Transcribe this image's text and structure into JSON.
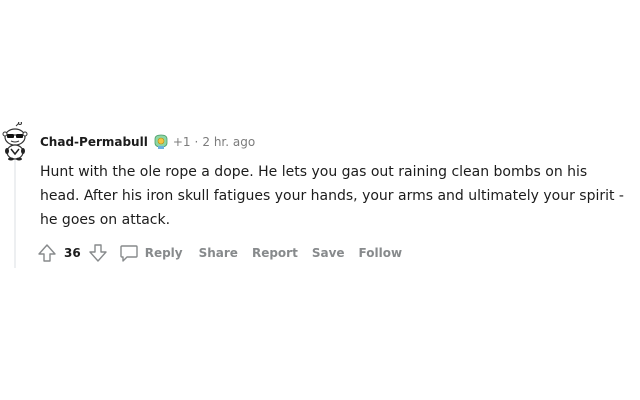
{
  "comment": {
    "username": "Chad-Permabull",
    "award_icon": "award-icon",
    "karma": "+1",
    "separator": "·",
    "time": "2 hr. ago",
    "body": [
      "Hunt with the ole rope a dope. He lets you gas out raining clean bombs on his head. After his iron skull fatigues your hands, your arms and ultimately your spirit - he goes on attack."
    ],
    "score": "36",
    "actions": {
      "reply": "Reply",
      "share": "Share",
      "report": "Report",
      "save": "Save",
      "follow": "Follow"
    }
  },
  "colors": {
    "text": "#1c1c1c",
    "meta": "#7c7c7c",
    "action": "#878a8c",
    "thread_line": "#edeff1"
  }
}
